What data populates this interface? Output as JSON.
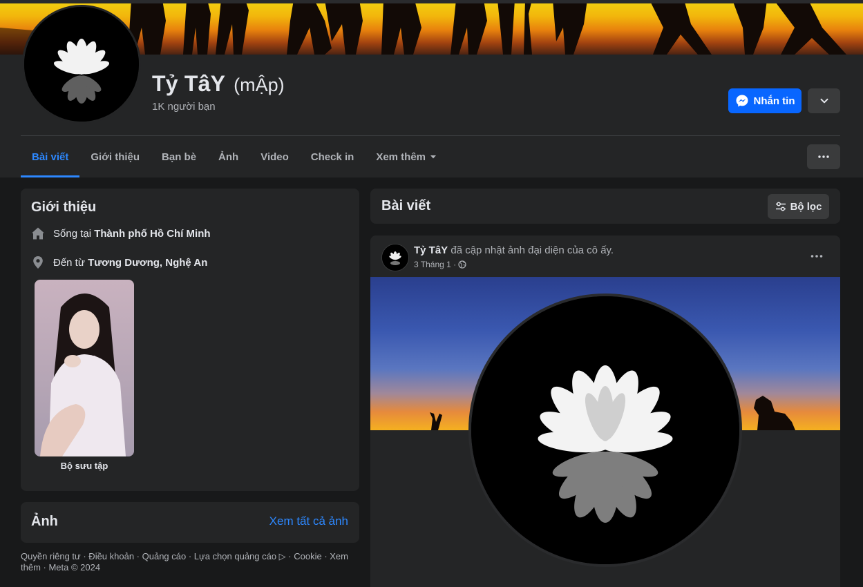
{
  "profile": {
    "name": "Tỷ TâY",
    "alt_name": "(mẬp)",
    "friend_count": "1K người bạn",
    "message_label": "Nhắn tin"
  },
  "tabs": [
    {
      "label": "Bài viết",
      "active": true
    },
    {
      "label": "Giới thiệu"
    },
    {
      "label": "Bạn bè"
    },
    {
      "label": "Ảnh"
    },
    {
      "label": "Video"
    },
    {
      "label": "Check in"
    },
    {
      "label": "Xem thêm"
    }
  ],
  "intro": {
    "title": "Giới thiệu",
    "lives_prefix": "Sống tại ",
    "lives_value": "Thành phố Hồ Chí Minh",
    "from_prefix": "Đến từ ",
    "from_value": "Tương Dương, Nghệ An",
    "featured_caption": "Bộ sưu tập"
  },
  "photos": {
    "title": "Ảnh",
    "see_all": "Xem tất cả ảnh"
  },
  "footer": {
    "text": "Quyền riêng tư · Điều khoản · Quảng cáo · Lựa chọn quảng cáo ▷ · Cookie · Xem thêm · Meta © 2024"
  },
  "posts": {
    "title": "Bài viết",
    "filter_label": "Bộ lọc",
    "items": [
      {
        "author": "Tỷ TâY",
        "action": " đã cập nhật ảnh đại diện của cô ấy.",
        "date": "3 Tháng 1 ·"
      }
    ]
  },
  "colors": {
    "background": "#18191a",
    "card": "#242526",
    "accent": "#2d88ff",
    "button_primary": "#0866ff",
    "button_secondary": "#3a3b3c"
  }
}
